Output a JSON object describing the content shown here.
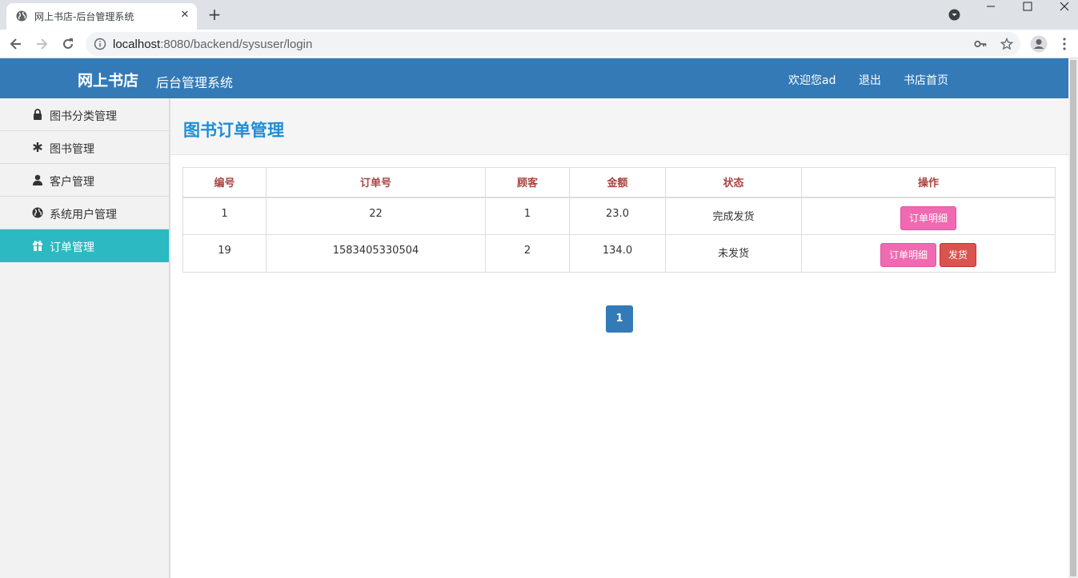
{
  "browser": {
    "tab_title": "网上书店-后台管理系统",
    "url_host": "localhost",
    "url_rest": ":8080/backend/sysuser/login"
  },
  "header": {
    "brand": "网上书店",
    "subtitle": "后台管理系统",
    "welcome": "欢迎您ad",
    "logout": "退出",
    "home": "书店首页"
  },
  "sidebar": {
    "items": [
      {
        "label": "图书分类管理",
        "icon": "lock-icon"
      },
      {
        "label": "图书管理",
        "icon": "asterisk-icon"
      },
      {
        "label": "客户管理",
        "icon": "user-icon"
      },
      {
        "label": "系统用户管理",
        "icon": "globe-icon"
      },
      {
        "label": "订单管理",
        "icon": "gift-icon",
        "active": true
      }
    ]
  },
  "main": {
    "title": "图书订单管理",
    "columns": [
      "编号",
      "订单号",
      "顾客",
      "金额",
      "状态",
      "操作"
    ],
    "rows": [
      {
        "id": "1",
        "order_no": "22",
        "customer": "1",
        "amount": "23.0",
        "status": "完成发货",
        "actions": [
          "订单明细"
        ]
      },
      {
        "id": "19",
        "order_no": "1583405330504",
        "customer": "2",
        "amount": "134.0",
        "status": "未发货",
        "actions": [
          "订单明细",
          "发货"
        ]
      }
    ],
    "pagination": {
      "current": "1"
    }
  },
  "colors": {
    "header_bg": "#337ab7",
    "active_nav": "#2cb9c2",
    "title": "#1e8dd6",
    "column_header": "#a94442",
    "detail_button": "#f06ab2",
    "ship_button": "#d9534f"
  }
}
